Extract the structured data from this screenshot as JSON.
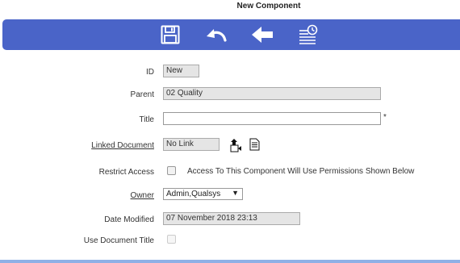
{
  "page": {
    "title": "New Component"
  },
  "toolbar": {
    "icons": [
      "save-icon",
      "undo-icon",
      "back-arrow-icon",
      "history-list-icon"
    ]
  },
  "form": {
    "id": {
      "label": "ID",
      "value": "New"
    },
    "parent": {
      "label": "Parent",
      "value": "02 Quality"
    },
    "title": {
      "label": "Title",
      "value": "",
      "required_marker": "*"
    },
    "linked_document": {
      "label": "Linked Document",
      "value": "No Link"
    },
    "restrict_access": {
      "label": "Restrict Access",
      "description": "Access To This Component Will Use Permissions Shown Below"
    },
    "owner": {
      "label": "Owner",
      "selected": "Admin,Qualsys"
    },
    "date_modified": {
      "label": "Date Modified",
      "value": "07 November 2018 23:13"
    },
    "use_document_title": {
      "label": "Use Document Title"
    }
  },
  "colors": {
    "toolbar": "#4a64c8",
    "bottom_line": "#8fb0e6"
  }
}
